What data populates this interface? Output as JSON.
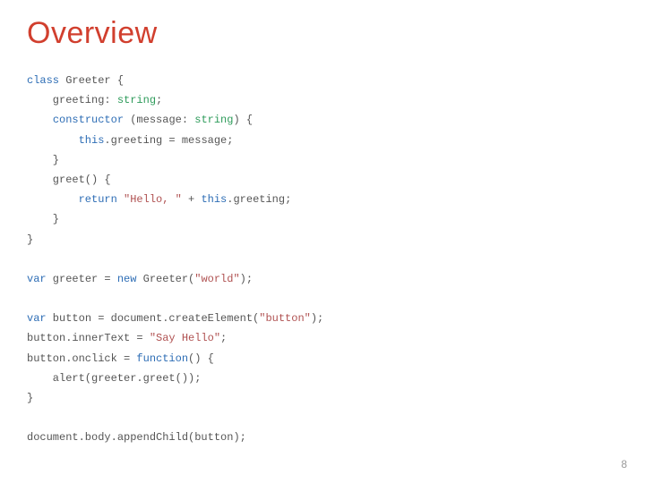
{
  "title": "Overview",
  "page_number": "8",
  "code": {
    "l1_a": "class",
    "l1_b": " Greeter {",
    "l2_a": "    greeting: ",
    "l2_b": "string",
    "l2_c": ";",
    "l3_a": "    ",
    "l3_b": "constructor",
    "l3_c": " (message: ",
    "l3_d": "string",
    "l3_e": ") {",
    "l4_a": "        ",
    "l4_b": "this",
    "l4_c": ".greeting = message;",
    "l5": "    }",
    "l6": "    greet() {",
    "l7_a": "        ",
    "l7_b": "return",
    "l7_c": " ",
    "l7_d": "\"Hello, \"",
    "l7_e": " + ",
    "l7_f": "this",
    "l7_g": ".greeting;",
    "l8": "    }",
    "l9": "}",
    "blank": "",
    "l10_a": "var",
    "l10_b": " greeter = ",
    "l10_c": "new",
    "l10_d": " Greeter(",
    "l10_e": "\"world\"",
    "l10_f": ");",
    "l11_a": "var",
    "l11_b": " button = document.createElement(",
    "l11_c": "\"button\"",
    "l11_d": ");",
    "l12_a": "button.innerText = ",
    "l12_b": "\"Say Hello\"",
    "l12_c": ";",
    "l13_a": "button.onclick = ",
    "l13_b": "function",
    "l13_c": "() {",
    "l14": "    alert(greeter.greet());",
    "l15": "}",
    "l16": "document.body.appendChild(button);"
  }
}
